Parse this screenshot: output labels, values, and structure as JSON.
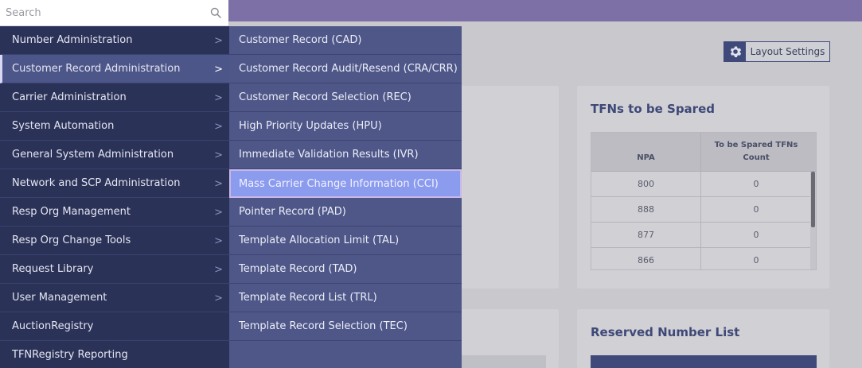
{
  "search": {
    "placeholder": "Search"
  },
  "menu": {
    "items": [
      {
        "label": "Number Administration",
        "has_sub": true
      },
      {
        "label": "Customer Record Administration",
        "has_sub": true,
        "active": true
      },
      {
        "label": "Carrier Administration",
        "has_sub": true
      },
      {
        "label": "System Automation",
        "has_sub": true
      },
      {
        "label": "General System Administration",
        "has_sub": true
      },
      {
        "label": "Network and SCP Administration",
        "has_sub": true
      },
      {
        "label": "Resp Org Management",
        "has_sub": true
      },
      {
        "label": "Resp Org Change Tools",
        "has_sub": true
      },
      {
        "label": "Request Library",
        "has_sub": true
      },
      {
        "label": "User Management",
        "has_sub": true
      },
      {
        "label": "AuctionRegistry",
        "has_sub": false
      },
      {
        "label": "TFNRegistry Reporting",
        "has_sub": false
      }
    ],
    "chevron": ">"
  },
  "submenu": {
    "items": [
      {
        "label": "Customer Record (CAD)"
      },
      {
        "label": "Customer Record Audit/Resend (CRA/CRR)"
      },
      {
        "label": "Customer Record Selection (REC)"
      },
      {
        "label": "High Priority Updates (HPU)"
      },
      {
        "label": "Immediate Validation Results (IVR)"
      },
      {
        "label": "Mass Carrier Change Information (CCI)",
        "highlighted": true
      },
      {
        "label": "Pointer Record (PAD)"
      },
      {
        "label": "Template Allocation Limit (TAL)"
      },
      {
        "label": "Template Record (TAD)"
      },
      {
        "label": "Template Record List (TRL)"
      },
      {
        "label": "Template Record Selection (TEC)"
      }
    ]
  },
  "layout_settings": {
    "label": "Layout Settings"
  },
  "tfn_card": {
    "title": "TFNs to be Spared",
    "columns": [
      "NPA",
      "To be Spared TFNs Count"
    ],
    "rows": [
      [
        "800",
        "0"
      ],
      [
        "888",
        "0"
      ],
      [
        "877",
        "0"
      ],
      [
        "866",
        "0"
      ]
    ]
  },
  "reserved_card": {
    "title": "Reserved Number List"
  },
  "colors": {
    "topbar": "#7c70a6",
    "menu_bg": "#2b3257",
    "submenu_bg": "#4e5788",
    "highlight": "#8b9bee",
    "accent": "#404a7a"
  }
}
